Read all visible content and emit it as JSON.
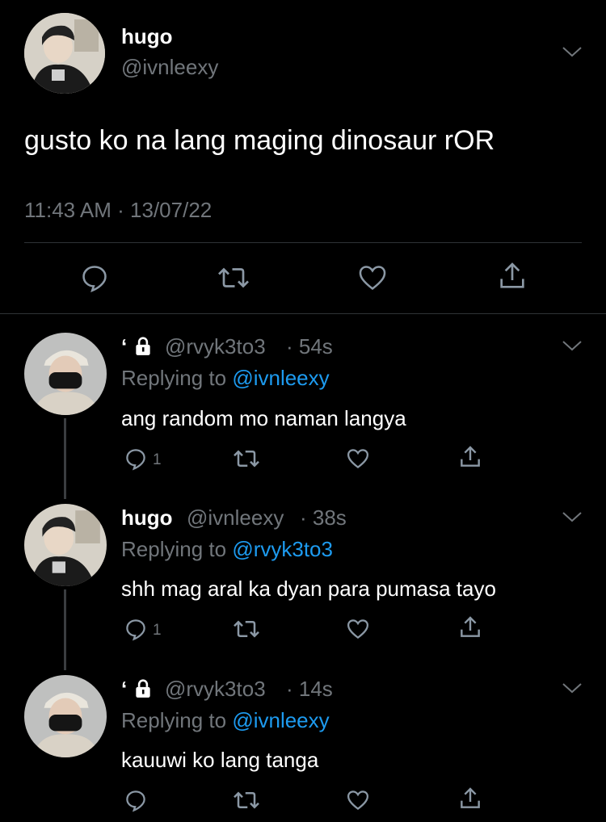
{
  "main_tweet": {
    "display_name": "hugo",
    "handle": "@ivnleexy",
    "text": "gusto ko na lang maging dinosaur rOR",
    "timestamp": "11:43 AM · 13/07/22",
    "avatar_icon": "avatar-hugo"
  },
  "replies": [
    {
      "display_name": "ʻ",
      "lock_icon": "lock-icon",
      "handle": "@rvyk3to3",
      "time": "· 54s",
      "replying_prefix": "Replying to",
      "replying_to": "@ivnleexy",
      "text": "ang random mo naman langya",
      "reply_count": "1"
    },
    {
      "display_name": "hugo",
      "handle": "@ivnleexy",
      "time": "· 38s",
      "replying_prefix": "Replying to",
      "replying_to": "@rvyk3to3",
      "text": "shh mag aral ka dyan para pumasa tayo",
      "reply_count": "1"
    },
    {
      "display_name": "ʻ",
      "lock_icon": "lock-icon",
      "handle": "@rvyk3to3",
      "time": "· 14s",
      "replying_prefix": "Replying to",
      "replying_to": "@ivnleexy",
      "text": "kauuwi ko lang tanga",
      "reply_count": ""
    }
  ],
  "colors": {
    "background": "#000000",
    "muted": "#71767b",
    "link": "#1d9bf0",
    "divider": "#2f3336"
  }
}
